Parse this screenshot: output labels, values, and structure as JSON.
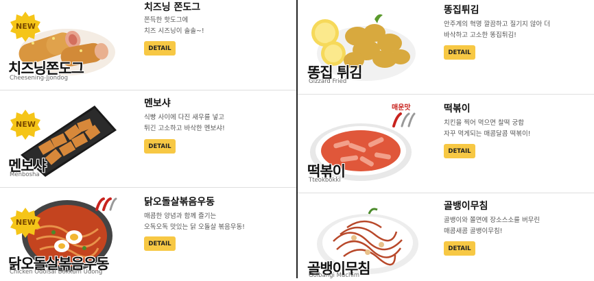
{
  "detail_label": "DETAIL",
  "badge_new": "NEW",
  "spicy_label": "매운맛",
  "left_items": [
    {
      "name": "치즈닝 쫀도그",
      "desc": "쫀득한 핫도그에\n치즈 시즈닝이 솔솔~!",
      "caption_ko": "치즈닝쫀도그",
      "caption_en": "Cheesening-Jjondog"
    },
    {
      "name": "멘보샤",
      "desc": "식빵 사이에 다진 새우를 넣고\n튀긴 고소하고 바삭한 멘보샤!",
      "caption_ko": "멘보샤",
      "caption_en": "Menbosha"
    },
    {
      "name": "닭오돌살볶음우동",
      "desc": "매콤한 양념과 함께 즐기는\n오독오독 맛있는 닭 오돌살 볶음우동!",
      "caption_ko": "닭오돌살볶음우동",
      "caption_en": "Chicken Odolsal Bokkum Udong"
    }
  ],
  "right_items": [
    {
      "name": "똥집튀김",
      "desc": "안주계의 혁명 깔끔하고 질기지 않아 더\n바삭하고 고소한 똥집튀김!",
      "caption_ko": "똥집 튀김",
      "caption_en": "Gizzard Fried"
    },
    {
      "name": "떡볶이",
      "desc": "치킨을 찍어 먹으면 찰떡 궁합\n자꾸 먹게되는 매콤달콤 떡볶이!",
      "caption_ko": "떡볶이",
      "caption_en": "Tteokbokki"
    },
    {
      "name": "골뱅이무침",
      "desc": "골뱅이와 쫄면에 장소스소를 버무린\n매콤새콤 골뱅이무침!",
      "caption_ko": "골뱅이무침",
      "caption_en": "Golbangi Muchim"
    }
  ],
  "colors": {
    "button": "#f7c844",
    "badge": "#f5c518",
    "divider": "#222222"
  }
}
